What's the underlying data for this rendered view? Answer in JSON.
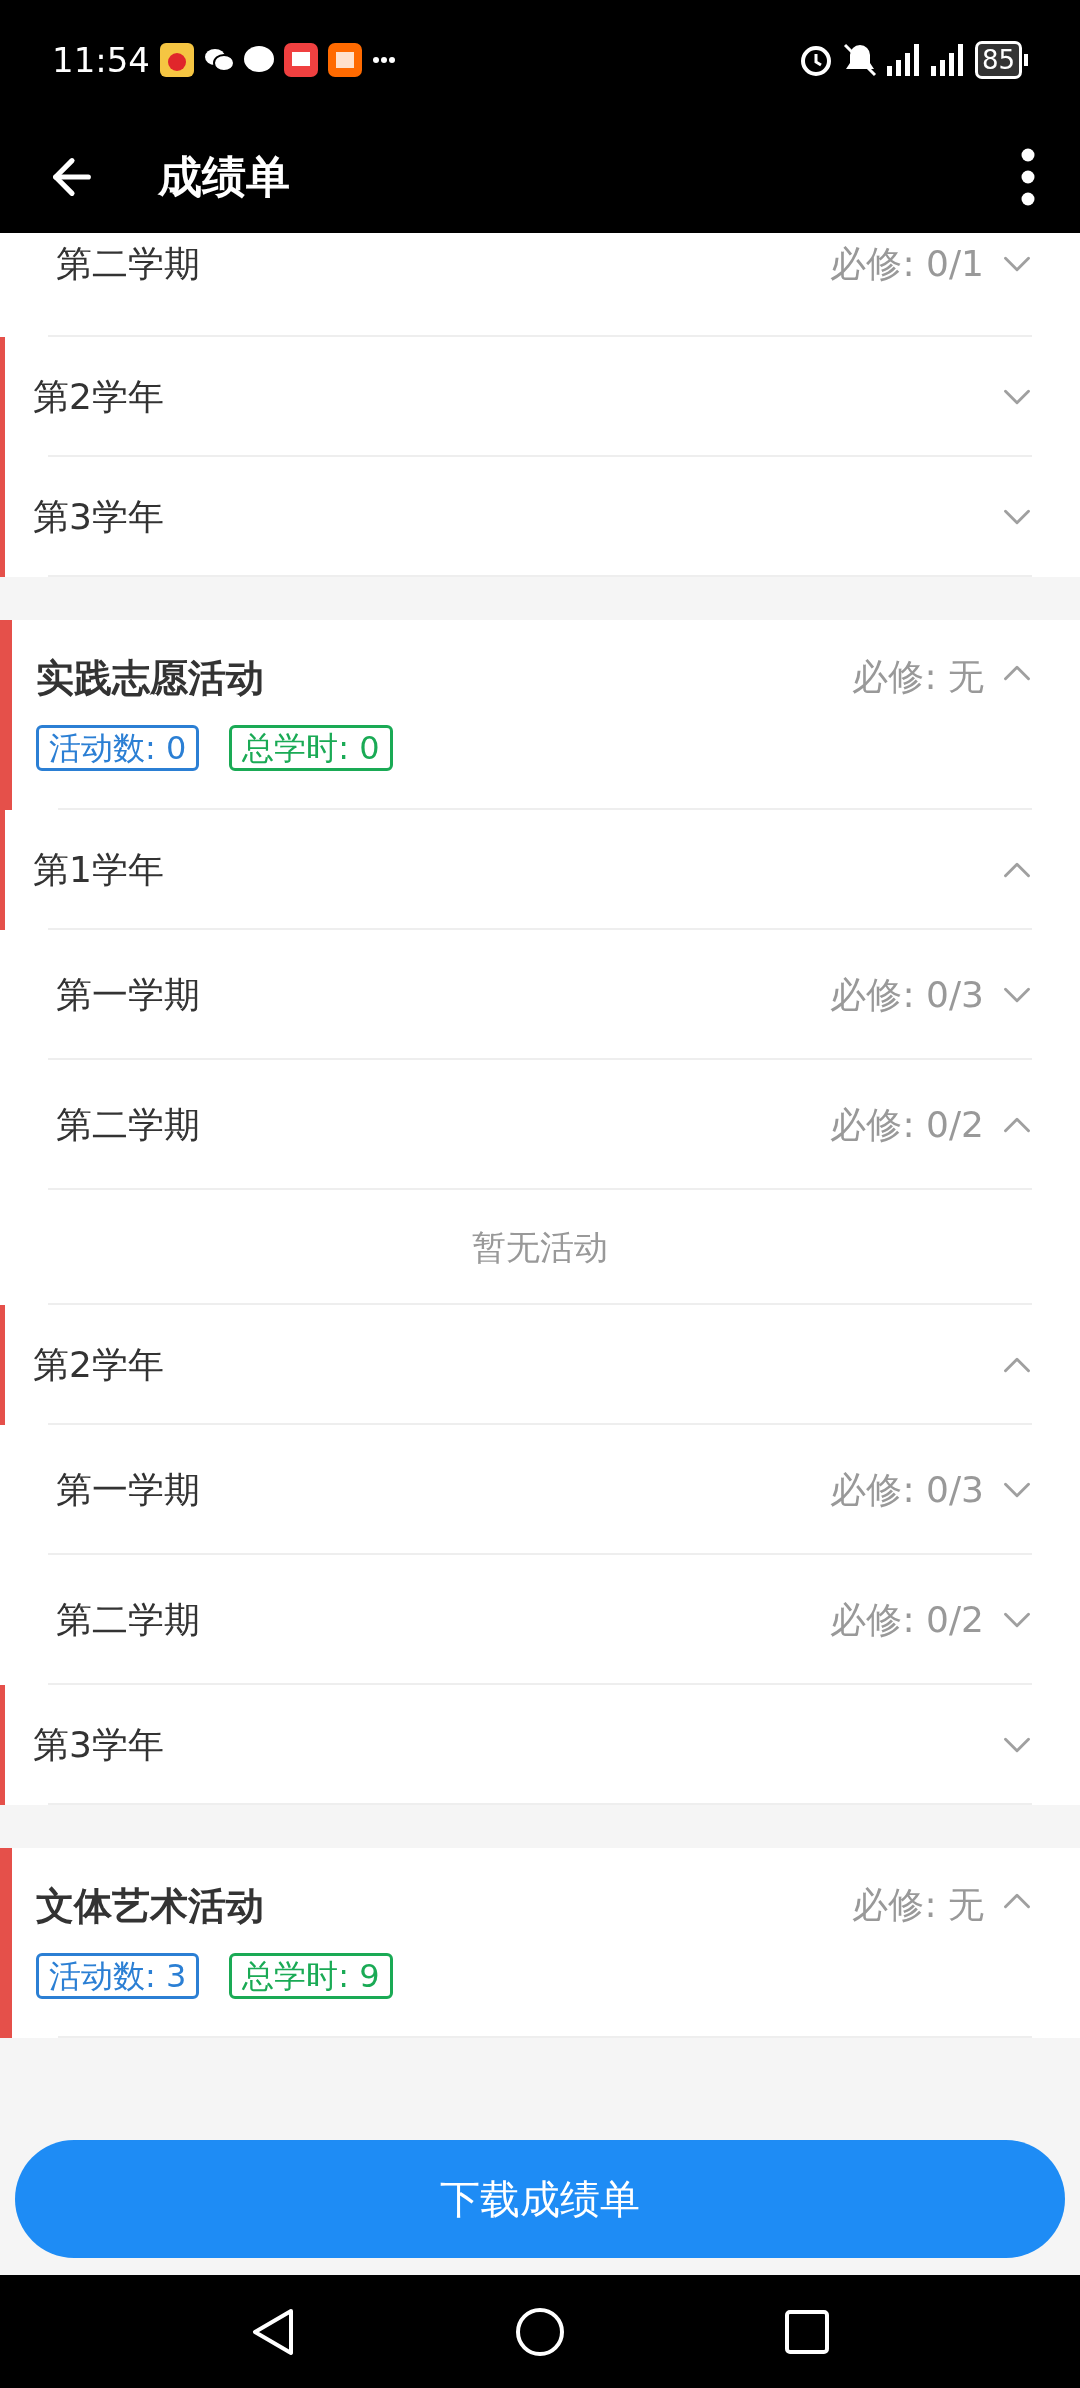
{
  "status_bar": {
    "time": "11:54",
    "battery": "85"
  },
  "app_bar": {
    "title": "成绩单"
  },
  "sections": [
    {
      "years": [
        {
          "semesters": [
            {
              "name": "第二学期",
              "required": "必修: 0/1",
              "expanded": false
            }
          ]
        },
        {
          "name": "第2学年",
          "expanded": false
        },
        {
          "name": "第3学年",
          "expanded": false
        }
      ]
    },
    {
      "title": "实践志愿活动",
      "required": "必修: 无",
      "expanded": true,
      "tags": [
        {
          "text": "活动数: 0",
          "color": "#2b7fd4"
        },
        {
          "text": "总学时: 0",
          "color": "#1aaa55"
        }
      ],
      "years": [
        {
          "name": "第1学年",
          "expanded": true,
          "semesters": [
            {
              "name": "第一学期",
              "required": "必修: 0/3",
              "expanded": false
            },
            {
              "name": "第二学期",
              "required": "必修: 0/2",
              "expanded": true,
              "empty_text": "暂无活动"
            }
          ]
        },
        {
          "name": "第2学年",
          "expanded": true,
          "semesters": [
            {
              "name": "第一学期",
              "required": "必修: 0/3",
              "expanded": false
            },
            {
              "name": "第二学期",
              "required": "必修: 0/2",
              "expanded": false
            }
          ]
        },
        {
          "name": "第3学年",
          "expanded": false
        }
      ]
    },
    {
      "title": "文体艺术活动",
      "required": "必修: 无",
      "expanded": true,
      "tags": [
        {
          "text": "活动数: 3",
          "color": "#2b7fd4"
        },
        {
          "text": "总学时: 9",
          "color": "#1aaa55"
        }
      ]
    }
  ],
  "download_button": {
    "label": "下载成绩单"
  }
}
